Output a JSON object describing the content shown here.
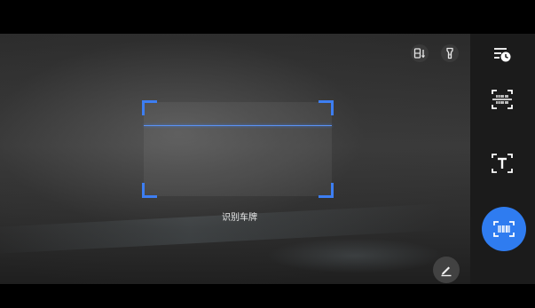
{
  "scanner": {
    "hint_text": "识别车牌"
  },
  "toolbar": {
    "orientation_icon": "screen-orientation-icon",
    "flash_icon": "flashlight-icon",
    "edit_icon": "edit-pen-icon"
  },
  "side_panel": {
    "items": [
      {
        "icon": "history-icon",
        "active": false
      },
      {
        "icon": "barcode-scan-icon",
        "active": false
      },
      {
        "icon": "text-recognition-icon",
        "active": false
      },
      {
        "icon": "scan-icon",
        "active": true
      }
    ]
  },
  "colors": {
    "accent": "#2f7cf0",
    "frame": "#3d7ef2",
    "panel_bg": "#1b1b1b"
  }
}
